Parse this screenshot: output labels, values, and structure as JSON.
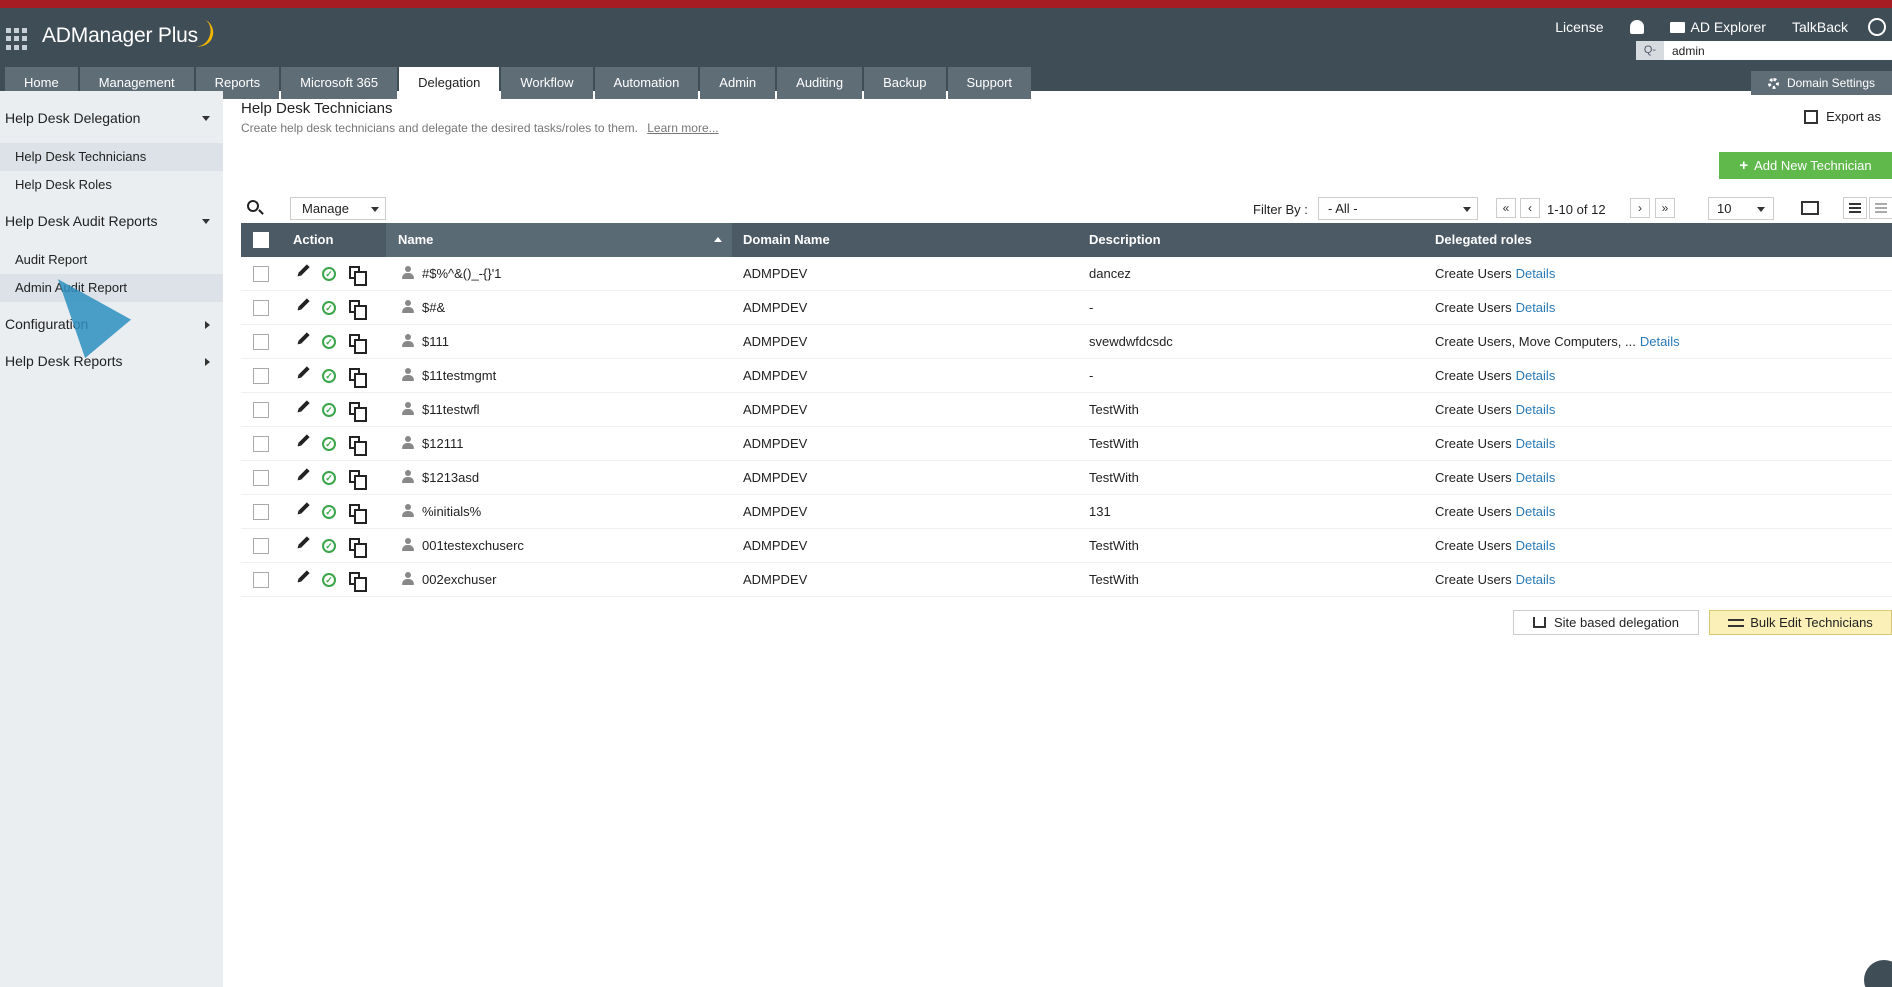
{
  "app": {
    "name": "ADManager Plus"
  },
  "header": {
    "links": {
      "license": "License",
      "ad_explorer": "AD Explorer",
      "talkback": "TalkBack"
    },
    "search": {
      "icon_label": "Q-",
      "value": "admin"
    },
    "domain_settings": "Domain Settings"
  },
  "tabs": [
    "Home",
    "Management",
    "Reports",
    "Microsoft 365",
    "Delegation",
    "Workflow",
    "Automation",
    "Admin",
    "Auditing",
    "Backup",
    "Support"
  ],
  "active_tab": "Delegation",
  "sidebar": {
    "section1": "Help Desk Delegation",
    "item1": "Help Desk Technicians",
    "item2": "Help Desk Roles",
    "section2": "Help Desk Audit Reports",
    "item3": "Audit Report",
    "item4": "Admin Audit Report",
    "section3": "Configuration",
    "section4": "Help Desk Reports"
  },
  "page": {
    "title": "Help Desk Technicians",
    "subtitle": "Create help desk technicians and delegate the desired tasks/roles to them.",
    "learn_more": "Learn more...",
    "export": "Export as",
    "add_button": "Add New Technician"
  },
  "toolbar": {
    "manage": "Manage",
    "filter_label": "Filter By :",
    "filter_value": "- All -",
    "pager": "1-10 of 12",
    "first": "«",
    "prev": "‹",
    "next": "›",
    "last": "»",
    "per_page": "10"
  },
  "table": {
    "headers": {
      "action": "Action",
      "name": "Name",
      "domain": "Domain Name",
      "description": "Description",
      "roles": "Delegated roles"
    },
    "details_label": "Details",
    "rows": [
      {
        "name": "#$%^&()_-{}'1",
        "domain": "ADMPDEV",
        "description": "dancez",
        "roles": "Create Users"
      },
      {
        "name": "$#&",
        "domain": "ADMPDEV",
        "description": "-",
        "roles": "Create Users"
      },
      {
        "name": "$111",
        "domain": "ADMPDEV",
        "description": "svewdwfdcsdc",
        "roles": "Create Users, Move Computers, ..."
      },
      {
        "name": "$11testmgmt",
        "domain": "ADMPDEV",
        "description": "-",
        "roles": "Create Users"
      },
      {
        "name": "$11testwfl",
        "domain": "ADMPDEV",
        "description": "TestWith",
        "roles": "Create Users"
      },
      {
        "name": "$12111",
        "domain": "ADMPDEV",
        "description": "TestWith",
        "roles": "Create Users"
      },
      {
        "name": "$1213asd",
        "domain": "ADMPDEV",
        "description": "TestWith",
        "roles": "Create Users"
      },
      {
        "name": "%initials%",
        "domain": "ADMPDEV",
        "description": "131",
        "roles": "Create Users"
      },
      {
        "name": "001testexchuserc",
        "domain": "ADMPDEV",
        "description": "TestWith",
        "roles": "Create Users"
      },
      {
        "name": "002exchuser",
        "domain": "ADMPDEV",
        "description": "TestWith",
        "roles": "Create Users"
      }
    ]
  },
  "bottom": {
    "site_delegation": "Site based delegation",
    "bulk_edit": "Bulk Edit Technicians"
  },
  "colors": {
    "header_bg": "#3f4d57",
    "accent_bar": "#a51d23",
    "add_button": "#5fb94b",
    "link": "#2a7ab8",
    "table_header": "#4b5a64"
  }
}
